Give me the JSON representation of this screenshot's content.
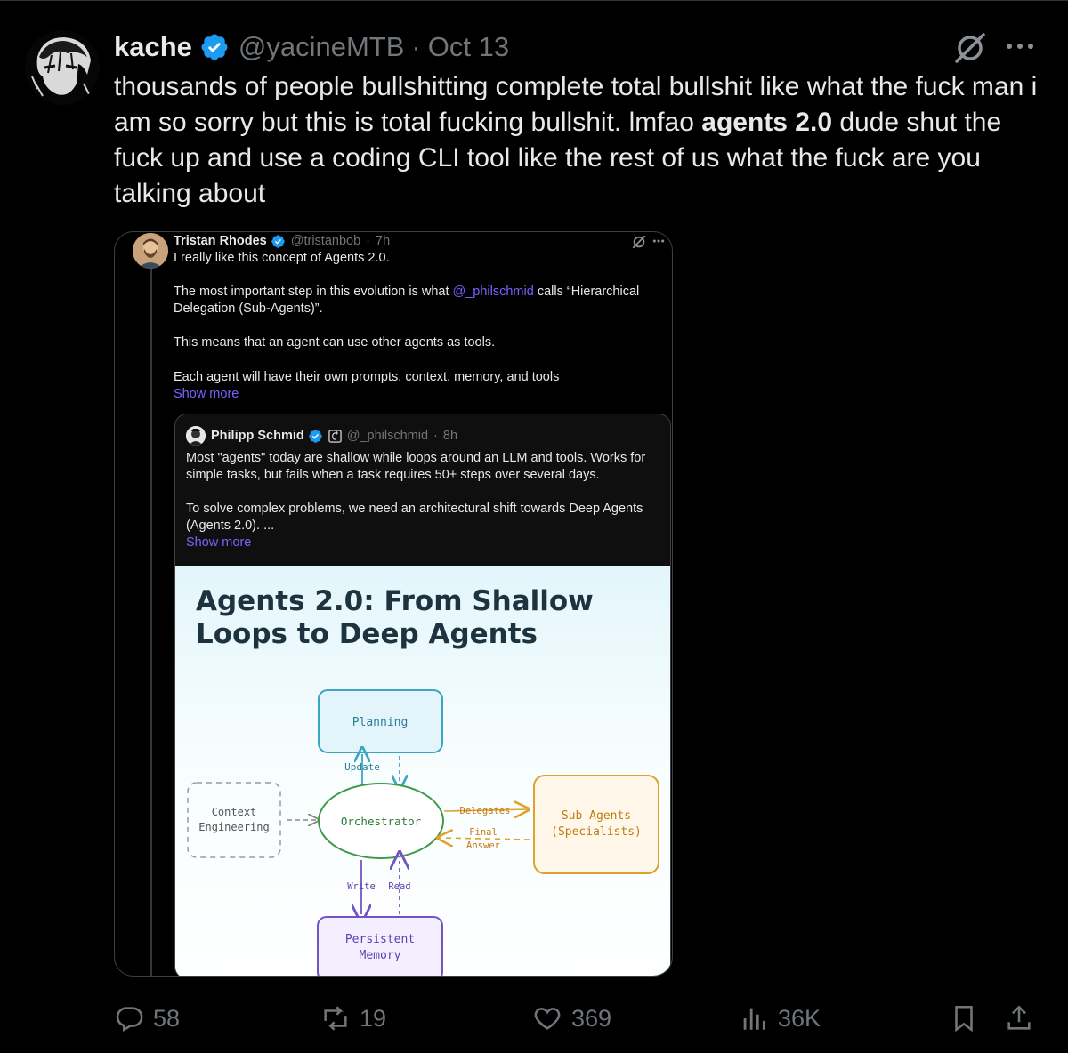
{
  "tweet": {
    "author_name": "kache",
    "handle": "@yacineMTB",
    "separator": "·",
    "date": "Oct 13",
    "text_1": "thousands of people bullshitting complete total bullshit like what the fuck man i am so sorry but this is total fucking bullshit. lmfao ",
    "text_bold": "agents 2.0",
    "text_2": " dude shut the fuck up and use a coding CLI tool like the rest of us what the fuck are you talking about"
  },
  "quote": {
    "author_name": "Tristan Rhodes",
    "handle": "@tristanbob",
    "separator": "·",
    "time": "7h",
    "line_1": "I really like this concept of Agents 2.0.",
    "line_2a": "The most important step in this evolution is what ",
    "mention": "@_philschmid",
    "line_2b": " calls “Hierarchical Delegation (Sub-Agents)”.",
    "line_3": "This means that an agent can use other agents as tools.",
    "line_4": "Each agent will have their own prompts, context, memory, and tools",
    "show_more": "Show more"
  },
  "nested_quote": {
    "author_name": "Philipp Schmid",
    "handle": "@_philschmid",
    "separator": "·",
    "time": "8h",
    "line_1": "Most \"agents\" today are shallow while loops around an LLM and tools. Works for simple tasks, but fails when a task requires 50+ steps over several days.",
    "line_2": "To solve complex problems, we need an architectural shift towards Deep Agents (Agents 2.0). ...",
    "show_more": "Show more"
  },
  "diagram": {
    "title_line_1": "Agents 2.0: From Shallow",
    "title_line_2": "Loops to Deep Agents",
    "planning": "Planning",
    "update": "Update",
    "orchestrator": "Orchestrator",
    "context_1": "Context",
    "context_2": "Engineering",
    "delegates": "Delegates",
    "final_1": "Final",
    "final_2": "Answer",
    "subagents_1": "Sub-Agents",
    "subagents_2": "(Specialists)",
    "write": "Write",
    "read": "Read",
    "memory_1": "Persistent",
    "memory_2": "Memory"
  },
  "actions": {
    "replies": "58",
    "reposts": "19",
    "likes": "369",
    "views": "36K"
  },
  "colors": {
    "background": "#000000",
    "text": "#e7e9ea",
    "muted": "#71767b",
    "verified": "#1d9bf0",
    "link": "#7a62ff",
    "planning": "#3aa6c2",
    "orchestrator": "#3e9a4a",
    "subagents": "#e0a12e",
    "memory": "#7454c4"
  },
  "icons": [
    "verified-badge-icon",
    "grok-icon",
    "more-icon",
    "reply-icon",
    "repost-icon",
    "like-icon",
    "views-icon",
    "bookmark-icon",
    "share-icon"
  ]
}
